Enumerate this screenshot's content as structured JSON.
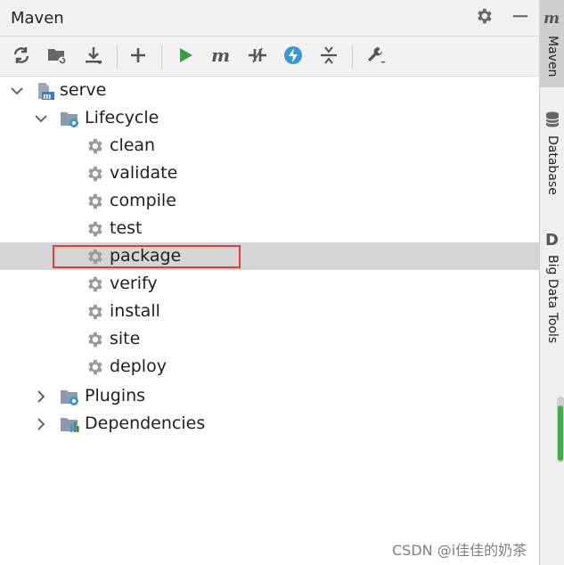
{
  "window": {
    "title": "Maven"
  },
  "toolbar": {
    "buttons": [
      {
        "name": "reload"
      },
      {
        "name": "generate-sources"
      },
      {
        "name": "download"
      },
      {
        "name": "add"
      },
      {
        "name": "run"
      },
      {
        "name": "execute-goal"
      },
      {
        "name": "toggle-offline"
      },
      {
        "name": "skip-tests"
      },
      {
        "name": "collapse"
      },
      {
        "name": "settings"
      }
    ]
  },
  "tree": {
    "project": {
      "label": "serve",
      "expanded": true
    },
    "lifecycle": {
      "label": "Lifecycle",
      "expanded": true,
      "items": [
        {
          "label": "clean"
        },
        {
          "label": "validate"
        },
        {
          "label": "compile"
        },
        {
          "label": "test"
        },
        {
          "label": "package",
          "selected": true
        },
        {
          "label": "verify"
        },
        {
          "label": "install"
        },
        {
          "label": "site"
        },
        {
          "label": "deploy"
        }
      ]
    },
    "plugins": {
      "label": "Plugins",
      "expanded": false
    },
    "dependencies": {
      "label": "Dependencies",
      "expanded": false
    }
  },
  "sidebar": {
    "tabs": [
      {
        "label": "Maven",
        "icon": "maven-icon",
        "active": true
      },
      {
        "label": "Database",
        "icon": "database-icon",
        "active": false
      },
      {
        "label": "Big Data Tools",
        "icon": "bigdata-icon",
        "active": false
      }
    ]
  },
  "watermark": "CSDN @i佳佳的奶茶",
  "colors": {
    "highlight": "#e33b3b",
    "run": "#3c9a4a",
    "selection": "#d5d5d5"
  }
}
